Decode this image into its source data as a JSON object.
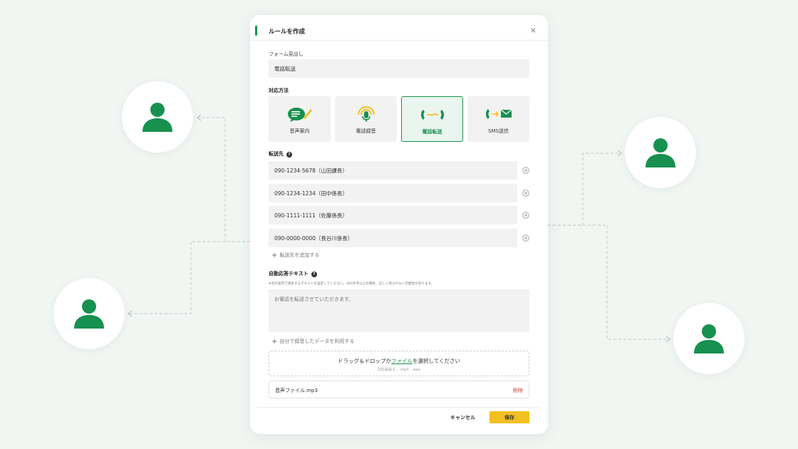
{
  "dialog": {
    "title": "ルールを作成",
    "close_label": "×"
  },
  "form_heading": {
    "label": "フォーム見出し",
    "value": "電話転送"
  },
  "method": {
    "label": "対応方法",
    "options": [
      {
        "label": "音声案内",
        "icon": "speech-bubble-pencil-icon"
      },
      {
        "label": "電話録音",
        "icon": "microphone-icon"
      },
      {
        "label": "電話転送",
        "icon": "call-forward-icon",
        "selected": true
      },
      {
        "label": "SMS送信",
        "icon": "phone-to-mail-icon"
      }
    ]
  },
  "destinations": {
    "label": "転送先",
    "help": "?",
    "items": [
      "090-1234-5678（山田課長）",
      "090-1234-1234（田中係長）",
      "090-1111-1111（佐藤係長）",
      "090-0000-0000（長谷川係長）"
    ],
    "add_label": "転送先を追加する"
  },
  "auto_reply": {
    "label": "自動応答テキスト",
    "help": "?",
    "note": "※音声案内で再生するテキストを設定してください。400文字以上の場合、正しく話されない可能性があります。",
    "placeholder": "お電話を転送させていただきます。",
    "use_recording_label": "自分で録音したデータを利用する"
  },
  "upload": {
    "text_before": "ドラッグ＆ドロップか",
    "link": "ファイル",
    "text_after": "を選択してください",
    "extensions": "対応拡張子：.mp3、.wav"
  },
  "file": {
    "name": "音声ファイル.mp3",
    "delete_label": "削除"
  },
  "footer": {
    "cancel_label": "キャンセル",
    "save_label": "保存"
  },
  "colors": {
    "accent_green": "#17914f",
    "save_yellow": "#f3c021",
    "delete_red": "#d63a2f",
    "background": "#f1f6f3"
  }
}
